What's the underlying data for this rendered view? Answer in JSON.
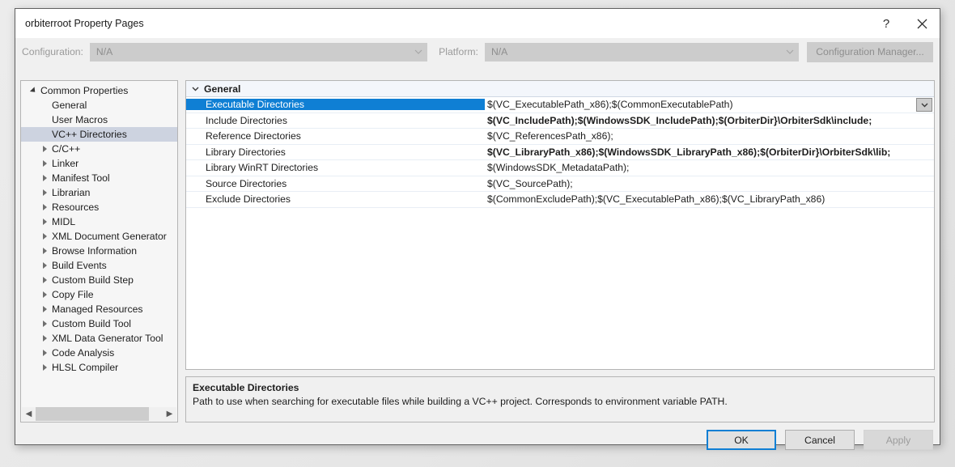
{
  "window": {
    "title": "orbiterroot Property Pages",
    "help_icon": "question-mark-icon",
    "close_icon": "close-icon"
  },
  "configbar": {
    "configuration_label": "Configuration:",
    "configuration_value": "N/A",
    "platform_label": "Platform:",
    "platform_value": "N/A",
    "configuration_manager_label": "Configuration Manager..."
  },
  "tree": {
    "selected": "VC++ Directories",
    "items": [
      {
        "label": "Common Properties",
        "level": 0,
        "expander": "expanded",
        "selected": false
      },
      {
        "label": "General",
        "level": 1,
        "expander": "none",
        "selected": false
      },
      {
        "label": "User Macros",
        "level": 1,
        "expander": "none",
        "selected": false
      },
      {
        "label": "VC++ Directories",
        "level": 1,
        "expander": "none",
        "selected": true
      },
      {
        "label": "C/C++",
        "level": 1,
        "expander": "collapsed",
        "selected": false
      },
      {
        "label": "Linker",
        "level": 1,
        "expander": "collapsed",
        "selected": false
      },
      {
        "label": "Manifest Tool",
        "level": 1,
        "expander": "collapsed",
        "selected": false
      },
      {
        "label": "Librarian",
        "level": 1,
        "expander": "collapsed",
        "selected": false
      },
      {
        "label": "Resources",
        "level": 1,
        "expander": "collapsed",
        "selected": false
      },
      {
        "label": "MIDL",
        "level": 1,
        "expander": "collapsed",
        "selected": false
      },
      {
        "label": "XML Document Generator",
        "level": 1,
        "expander": "collapsed",
        "selected": false
      },
      {
        "label": "Browse Information",
        "level": 1,
        "expander": "collapsed",
        "selected": false
      },
      {
        "label": "Build Events",
        "level": 1,
        "expander": "collapsed",
        "selected": false
      },
      {
        "label": "Custom Build Step",
        "level": 1,
        "expander": "collapsed",
        "selected": false
      },
      {
        "label": "Copy File",
        "level": 1,
        "expander": "collapsed",
        "selected": false
      },
      {
        "label": "Managed Resources",
        "level": 1,
        "expander": "collapsed",
        "selected": false
      },
      {
        "label": "Custom Build Tool",
        "level": 1,
        "expander": "collapsed",
        "selected": false
      },
      {
        "label": "XML Data Generator Tool",
        "level": 1,
        "expander": "collapsed",
        "selected": false
      },
      {
        "label": "Code Analysis",
        "level": 1,
        "expander": "collapsed",
        "selected": false
      },
      {
        "label": "HLSL Compiler",
        "level": 1,
        "expander": "collapsed",
        "selected": false
      }
    ]
  },
  "grid": {
    "group_label": "General",
    "group_expander": "expanded",
    "rows": [
      {
        "name": "Executable Directories",
        "value": "$(VC_ExecutablePath_x86);$(CommonExecutablePath)",
        "modified": false,
        "selected": true,
        "has_dropdown": true
      },
      {
        "name": "Include Directories",
        "value": "$(VC_IncludePath);$(WindowsSDK_IncludePath);$(OrbiterDir}\\OrbiterSdk\\include;",
        "modified": true,
        "selected": false,
        "has_dropdown": false
      },
      {
        "name": "Reference Directories",
        "value": "$(VC_ReferencesPath_x86);",
        "modified": false,
        "selected": false,
        "has_dropdown": false
      },
      {
        "name": "Library Directories",
        "value": "$(VC_LibraryPath_x86);$(WindowsSDK_LibraryPath_x86);$(OrbiterDir}\\OrbiterSdk\\lib;",
        "modified": true,
        "selected": false,
        "has_dropdown": false
      },
      {
        "name": "Library WinRT Directories",
        "value": "$(WindowsSDK_MetadataPath);",
        "modified": false,
        "selected": false,
        "has_dropdown": false
      },
      {
        "name": "Source Directories",
        "value": "$(VC_SourcePath);",
        "modified": false,
        "selected": false,
        "has_dropdown": false
      },
      {
        "name": "Exclude Directories",
        "value": "$(CommonExcludePath);$(VC_ExecutablePath_x86);$(VC_LibraryPath_x86)",
        "modified": false,
        "selected": false,
        "has_dropdown": false
      }
    ]
  },
  "description": {
    "title": "Executable Directories",
    "text": "Path to use when searching for executable files while building a VC++ project.  Corresponds to environment variable PATH."
  },
  "footer": {
    "ok_label": "OK",
    "cancel_label": "Cancel",
    "apply_label": "Apply",
    "apply_disabled": true
  },
  "colors": {
    "selection_blue": "#0f7fd4",
    "tree_selection": "#cdd3e0",
    "group_header_bg": "#f3f6fb",
    "dialog_bg": "#f0f0f0"
  }
}
